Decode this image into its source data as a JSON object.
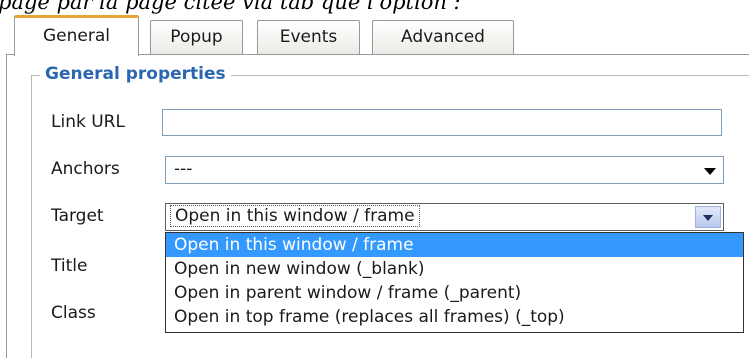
{
  "caption": "page par la page citée via tab que l'option :",
  "tabs": [
    {
      "label": "General",
      "active": true
    },
    {
      "label": "Popup",
      "active": false
    },
    {
      "label": "Events",
      "active": false
    },
    {
      "label": "Advanced",
      "active": false
    }
  ],
  "section": {
    "legend": "General properties"
  },
  "fields": {
    "link_url": {
      "label": "Link URL",
      "value": ""
    },
    "anchors": {
      "label": "Anchors",
      "value": "---"
    },
    "target": {
      "label": "Target",
      "value": "Open in this window / frame"
    },
    "title": {
      "label": "Title"
    },
    "class": {
      "label": "Class"
    }
  },
  "target_options": [
    {
      "label": "Open in this window / frame",
      "selected": true
    },
    {
      "label": "Open in new window (_blank)",
      "selected": false
    },
    {
      "label": "Open in parent window / frame (_parent)",
      "selected": false
    },
    {
      "label": "Open in top frame (replaces all frames) (_top)",
      "selected": false
    }
  ],
  "colors": {
    "active_tab_accent": "#e8a43a",
    "legend": "#2b67b1",
    "selection": "#3399ff"
  }
}
